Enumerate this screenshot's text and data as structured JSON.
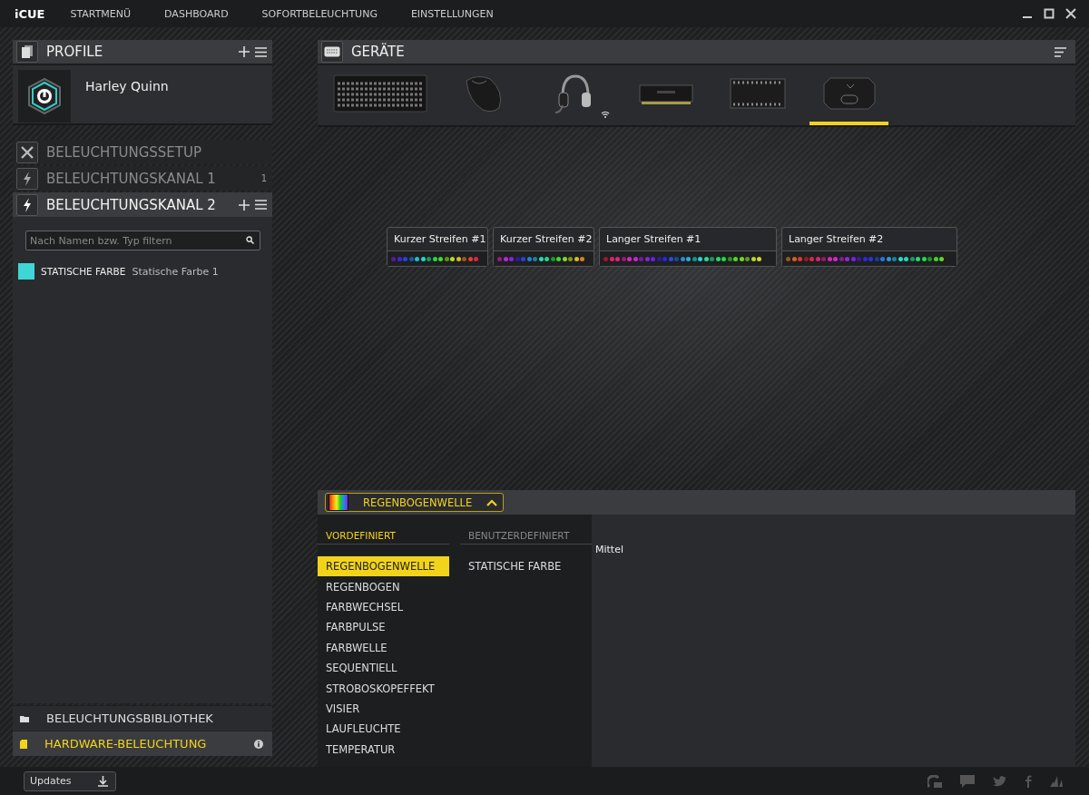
{
  "app": {
    "logo": "iCUE",
    "nav": [
      {
        "label": "STARTMENÜ"
      },
      {
        "label": "DASHBOARD"
      },
      {
        "label": "SOFORTBELEUCHTUNG"
      },
      {
        "label": "EINSTELLUNGEN"
      }
    ]
  },
  "profiles": {
    "title": "PROFILE",
    "active_profile": "Harley Quinn"
  },
  "sections": [
    {
      "kind": "setup",
      "label": "BELEUCHTUNGSSETUP",
      "selected": false
    },
    {
      "kind": "channel",
      "label": "BELEUCHTUNGSKANAL 1",
      "count": "1",
      "selected": false
    },
    {
      "kind": "channel",
      "label": "BELEUCHTUNGSKANAL 2",
      "selected": true
    }
  ],
  "filter": {
    "placeholder": "Nach Namen bzw. Typ filtern"
  },
  "layers": [
    {
      "type": "STATISCHE FARBE",
      "name": "Statische Farbe 1",
      "color": "#3fd6d6"
    }
  ],
  "library": [
    {
      "kind": "library",
      "label": "BELEUCHTUNGSBIBLIOTHEK",
      "selected": false
    },
    {
      "kind": "hardware",
      "label": "HARDWARE-BELEUCHTUNG",
      "selected": true
    }
  ],
  "devices": {
    "title": "GERÄTE",
    "items": [
      {
        "kind": "keyboard",
        "selected": false
      },
      {
        "kind": "mouse",
        "selected": false
      },
      {
        "kind": "headset",
        "selected": false,
        "wireless": true
      },
      {
        "kind": "memory",
        "selected": false
      },
      {
        "kind": "controller",
        "selected": false
      },
      {
        "kind": "hub",
        "selected": true
      }
    ]
  },
  "strips": [
    {
      "name": "Kurzer Streifen #1",
      "kind": "short"
    },
    {
      "name": "Kurzer Streifen #2",
      "kind": "short"
    },
    {
      "name": "Langer Streifen #1",
      "kind": "long"
    },
    {
      "name": "Langer Streifen #2",
      "kind": "long"
    }
  ],
  "effect": {
    "current": "REGENBOGENWELLE",
    "expanded": true,
    "speed": "Mittel",
    "groups": [
      {
        "title": "VORDEFINIERT",
        "selected": true,
        "items": [
          {
            "label": "REGENBOGENWELLE",
            "selected": true
          },
          {
            "label": "REGENBOGEN",
            "selected": false
          },
          {
            "label": "FARBWECHSEL",
            "selected": false
          },
          {
            "label": "FARBPULSE",
            "selected": false
          },
          {
            "label": "FARBWELLE",
            "selected": false
          },
          {
            "label": "SEQUENTIELL",
            "selected": false
          },
          {
            "label": "STROBOSKOPEFFEKT",
            "selected": false
          },
          {
            "label": "VISIER",
            "selected": false
          },
          {
            "label": "LAUFLEUCHTE",
            "selected": false
          },
          {
            "label": "TEMPERATUR",
            "selected": false
          }
        ]
      },
      {
        "title": "BENUTZERDEFINIERT",
        "selected": false,
        "items": [
          {
            "label": "STATISCHE FARBE",
            "selected": false
          }
        ]
      }
    ]
  },
  "footer": {
    "updates": "Updates"
  }
}
